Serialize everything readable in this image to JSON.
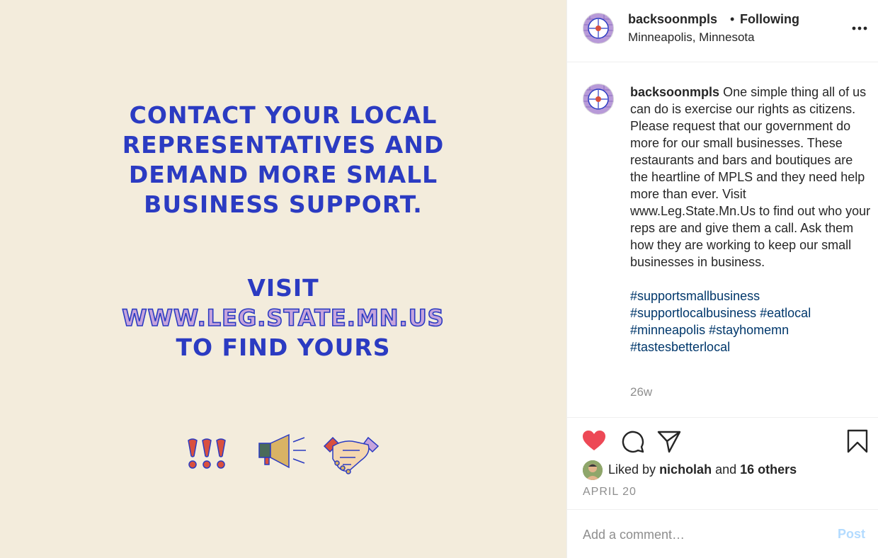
{
  "poster": {
    "headline_lines": [
      "CONTACT YOUR LOCAL",
      "REPRESENTATIVES AND",
      "DEMAND MORE SMALL",
      "BUSINESS SUPPORT."
    ],
    "visit_line": "VISIT",
    "url_line": "WWW.LEG.STATE.MN.US",
    "find_line": "TO FIND YOURS",
    "icons": [
      "exclamation-marks-icon",
      "megaphone-icon",
      "handshake-icon"
    ],
    "colors": {
      "background": "#f3ecdc",
      "text": "#2b3bc2",
      "accent": "#c6a4dc"
    }
  },
  "header": {
    "username": "backsoonmpls",
    "separator": "•",
    "follow_status": "Following",
    "location": "Minneapolis, Minnesota"
  },
  "caption": {
    "username": "backsoonmpls",
    "text": "One simple thing all of us can do is exercise our rights as citizens. Please request that our government do more for our small businesses. These restaurants and bars and boutiques are the heartline of MPLS and they need help more than ever. Visit www.Leg.State.Mn.Us to find out who your reps are and give them a call. Ask them how they are working to keep our small businesses in business.",
    "hashtags": [
      "#supportsmallbusiness",
      "#supportlocalbusiness",
      "#eatlocal",
      "#minneapolis",
      "#stayhomemn",
      "#tastesbetterlocal"
    ],
    "age": "26w"
  },
  "actions": {
    "liked_prefix": "Liked by",
    "liked_user": "nicholah",
    "liked_and": "and",
    "liked_others": "16 others",
    "date": "APRIL 20",
    "like_color": "#ed4956"
  },
  "comment": {
    "placeholder": "Add a comment…",
    "post_label": "Post"
  }
}
